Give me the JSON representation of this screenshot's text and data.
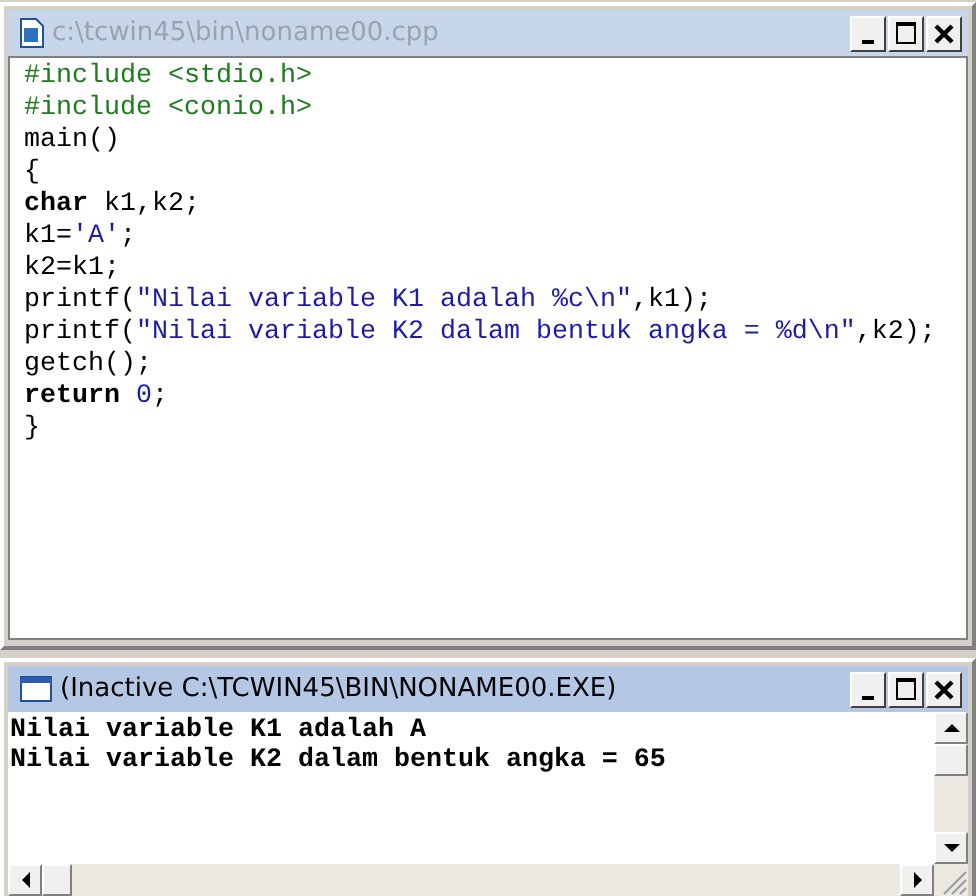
{
  "editor": {
    "title": "c:\\tcwin45\\bin\\noname00.cpp",
    "lines": [
      [
        {
          "kind": "preproc",
          "text": "#include <stdio.h>"
        }
      ],
      [
        {
          "kind": "preproc",
          "text": "#include <conio.h>"
        }
      ],
      [
        {
          "kind": "plain",
          "text": "main()"
        }
      ],
      [
        {
          "kind": "plain",
          "text": "{"
        }
      ],
      [
        {
          "kind": "keyword",
          "text": "char"
        },
        {
          "kind": "plain",
          "text": " k1,k2;"
        }
      ],
      [
        {
          "kind": "plain",
          "text": "k1="
        },
        {
          "kind": "string",
          "text": "'A'"
        },
        {
          "kind": "plain",
          "text": ";"
        }
      ],
      [
        {
          "kind": "plain",
          "text": "k2=k1;"
        }
      ],
      [
        {
          "kind": "plain",
          "text": "printf("
        },
        {
          "kind": "string",
          "text": "\"Nilai variable K1 adalah %c\\n\""
        },
        {
          "kind": "plain",
          "text": ",k1);"
        }
      ],
      [
        {
          "kind": "plain",
          "text": "printf("
        },
        {
          "kind": "string",
          "text": "\"Nilai variable K2 dalam bentuk angka = %d\\n\""
        },
        {
          "kind": "plain",
          "text": ",k2);"
        }
      ],
      [
        {
          "kind": "plain",
          "text": "getch();"
        }
      ],
      [
        {
          "kind": "keyword",
          "text": "return"
        },
        {
          "kind": "number",
          "text": " 0"
        },
        {
          "kind": "plain",
          "text": ";"
        }
      ],
      [
        {
          "kind": "plain",
          "text": "}"
        }
      ]
    ]
  },
  "console": {
    "title": "(Inactive C:\\TCWIN45\\BIN\\NONAME00.EXE)",
    "lines": [
      "Nilai variable K1 adalah A",
      "Nilai variable K2 dalam bentuk angka = 65"
    ]
  }
}
